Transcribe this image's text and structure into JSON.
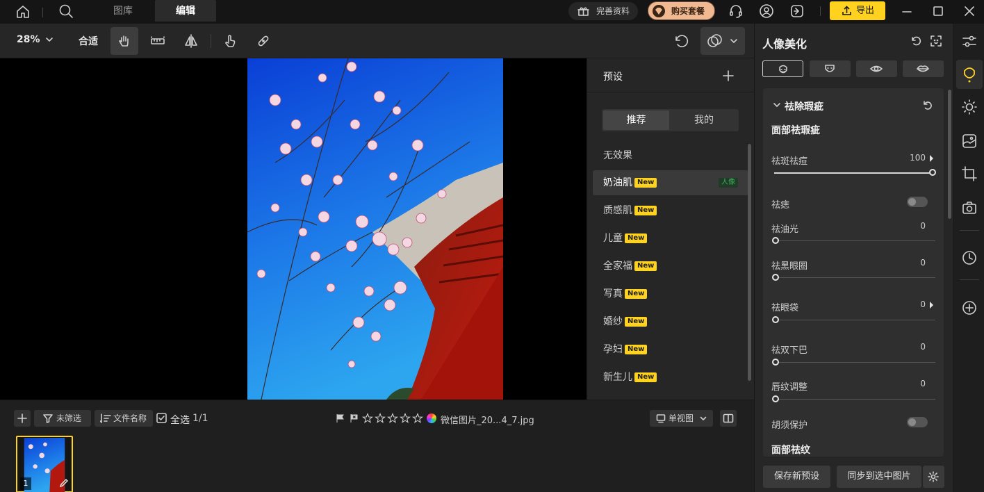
{
  "nav": {
    "tabs": [
      {
        "label": "图库"
      },
      {
        "label": "编辑"
      }
    ],
    "complete_info": "完善资料",
    "buy_plan": "购买套餐",
    "export": "导出"
  },
  "toolbar": {
    "zoom": "28%",
    "fit": "合适"
  },
  "presets": {
    "title": "预设",
    "tab_recommend": "推荐",
    "tab_mine": "我的",
    "new_badge": "New",
    "portrait_tag": "人像",
    "items": [
      {
        "label": "无效果"
      },
      {
        "label": "奶油肌"
      },
      {
        "label": "质感肌"
      },
      {
        "label": "儿童"
      },
      {
        "label": "全家福"
      },
      {
        "label": "写真"
      },
      {
        "label": "婚纱"
      },
      {
        "label": "孕妇"
      },
      {
        "label": "新生儿"
      }
    ]
  },
  "bottom": {
    "filter": "未筛选",
    "sort": "文件名称",
    "select_all": "全选",
    "count": "1/1",
    "filename": "微信图片_20...4_7.jpg",
    "view_mode": "单视图",
    "thumb_index": "1",
    "rating": 0
  },
  "panel": {
    "title": "人像美化",
    "section_title": "祛除瑕疵",
    "subsection": "面部祛瑕疵",
    "sliders": [
      {
        "label": "祛斑祛痘",
        "value": "100",
        "level": 1.0,
        "has_arrow": true
      },
      {
        "label": "祛油光",
        "value": "0",
        "level": 0.0
      },
      {
        "label": "祛黑眼圈",
        "value": "0",
        "level": 0.0
      },
      {
        "label": "祛眼袋",
        "value": "0",
        "level": 0.0,
        "has_arrow": true
      },
      {
        "label": "祛双下巴",
        "value": "0",
        "level": 0.0
      },
      {
        "label": "唇纹调整",
        "value": "0",
        "level": 0.0
      }
    ],
    "toggles": [
      {
        "label": "祛痣",
        "on": false
      },
      {
        "label": "胡须保护",
        "on": false
      }
    ],
    "next_section_partial": "面部祛纹",
    "save_preset": "保存新预设",
    "sync_selected": "同步到选中图片"
  },
  "colors": {
    "accent": "#ffd21f",
    "new_badge": "#ffd21f",
    "portrait_tag": "#3fae5a",
    "sky": "#1b6fe6",
    "roof_red": "#b3180e"
  }
}
